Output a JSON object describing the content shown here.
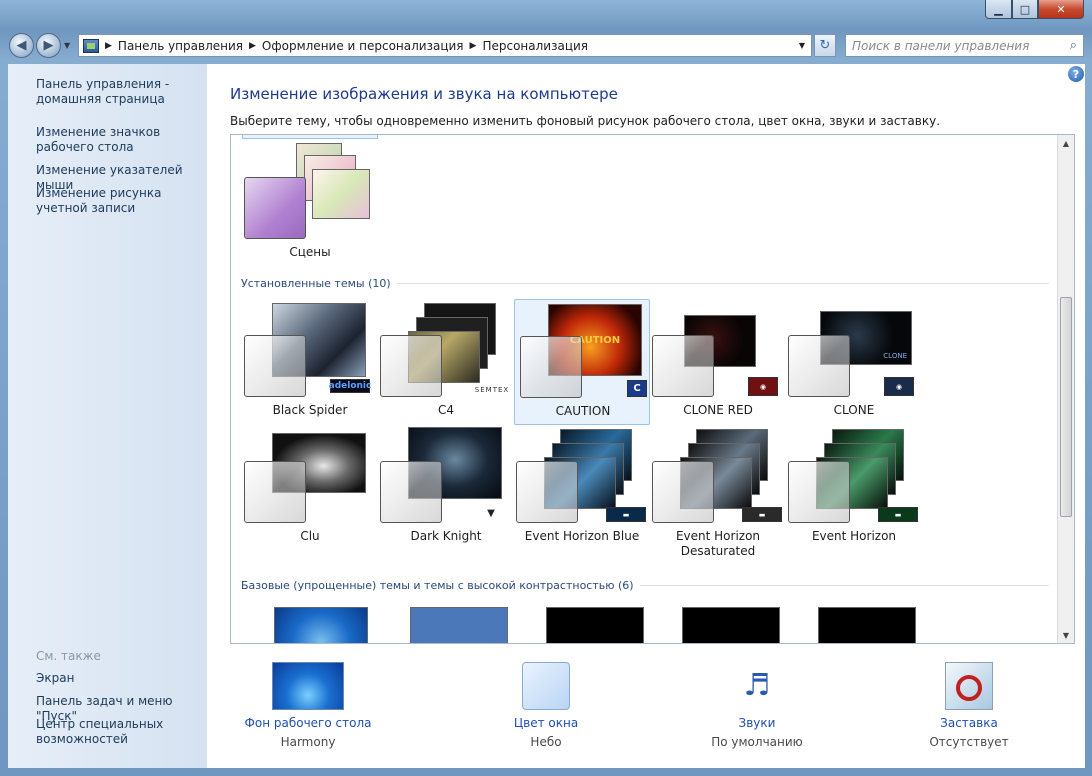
{
  "window": {
    "search_placeholder": "Поиск в панели управления",
    "breadcrumb": [
      "Панель управления",
      "Оформление и персонализация",
      "Персонализация"
    ]
  },
  "sidebar": {
    "links": [
      "Панель управления - домашняя страница",
      "Изменение значков рабочего стола",
      "Изменение указателей мыши",
      "Изменение рисунка учетной записи"
    ],
    "see_also_label": "См. также",
    "see_also": [
      "Экран",
      "Панель задач и меню \"Пуск\"",
      "Центр специальных возможностей"
    ]
  },
  "main": {
    "title": "Изменение изображения и звука на компьютере",
    "subtitle": "Выберите тему, чтобы одновременно изменить фоновый рисунок рабочего стола, цвет окна, звуки и заставку.",
    "top_theme": "Сцены",
    "installed_header": "Установленные темы (10)",
    "basic_header": "Базовые (упрощенные) темы и темы с высокой контрастностью (6)",
    "themes": [
      {
        "name": "Black Spider",
        "badge": "adelonic"
      },
      {
        "name": "C4",
        "badge": "SEMTEX"
      },
      {
        "name": "CAUTION",
        "badge": "C"
      },
      {
        "name": "CLONE RED",
        "badge": ""
      },
      {
        "name": "CLONE",
        "badge": ""
      },
      {
        "name": "Clu",
        "badge": ""
      },
      {
        "name": "Dark Knight",
        "badge": ""
      },
      {
        "name": "Event Horizon Blue",
        "badge": ""
      },
      {
        "name": "Event Horizon Desaturated",
        "badge": ""
      },
      {
        "name": "Event Horizon",
        "badge": ""
      }
    ],
    "wall_texts": {
      "caution": "CAUTION",
      "clone": "CLONE"
    }
  },
  "bottom": [
    {
      "link": "Фон рабочего стола",
      "value": "Harmony"
    },
    {
      "link": "Цвет окна",
      "value": "Небо"
    },
    {
      "link": "Звуки",
      "value": "По умолчанию"
    },
    {
      "link": "Заставка",
      "value": "Отсутствует"
    }
  ],
  "colors": {
    "title": "#1e3a8a",
    "link": "#1e50b0",
    "group_header": "#2a4a7a"
  }
}
